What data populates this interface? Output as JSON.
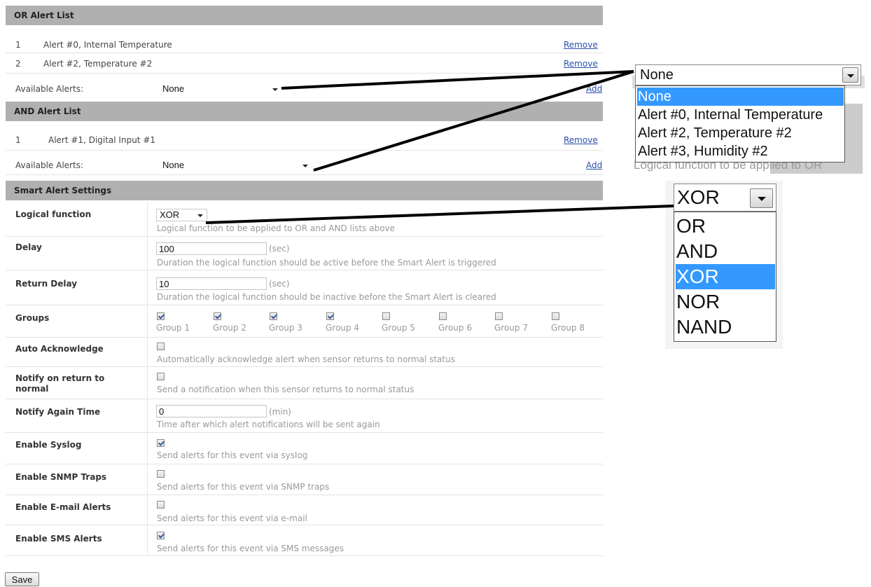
{
  "or_list": {
    "title": "OR Alert List",
    "items": [
      {
        "index": "1",
        "name": "Alert #0, Internal Temperature",
        "action": "Remove"
      },
      {
        "index": "2",
        "name": "Alert #2, Temperature #2",
        "action": "Remove"
      }
    ],
    "available_label": "Available Alerts:",
    "select_value": "None",
    "add_label": "Add"
  },
  "and_list": {
    "title": "AND Alert List",
    "items": [
      {
        "index": "1",
        "name": "Alert #1, Digital Input #1",
        "action": "Remove"
      }
    ],
    "available_label": "Available Alerts:",
    "select_value": "None",
    "add_label": "Add"
  },
  "settings": {
    "title": "Smart Alert Settings",
    "logical_function": {
      "label": "Logical function",
      "value": "XOR",
      "desc": "Logical function to be applied to OR and AND lists above"
    },
    "delay": {
      "label": "Delay",
      "value": "100",
      "unit": "(sec)",
      "desc": "Duration the logical function should be active before the Smart Alert is triggered"
    },
    "return_delay": {
      "label": "Return Delay",
      "value": "10",
      "unit": "(sec)",
      "desc": "Duration the logical function should be inactive before the Smart Alert is cleared"
    },
    "groups": {
      "label": "Groups",
      "items": [
        {
          "label": "Group 1",
          "checked": true
        },
        {
          "label": "Group 2",
          "checked": true
        },
        {
          "label": "Group 3",
          "checked": true
        },
        {
          "label": "Group 4",
          "checked": true
        },
        {
          "label": "Group 5",
          "checked": false
        },
        {
          "label": "Group 6",
          "checked": false
        },
        {
          "label": "Group 7",
          "checked": false
        },
        {
          "label": "Group 8",
          "checked": false
        }
      ]
    },
    "auto_ack": {
      "label": "Auto Acknowledge",
      "checked": false,
      "desc": "Automatically acknowledge alert when sensor returns to normal status"
    },
    "notify_return": {
      "label_line1": "Notify on return to",
      "label_line2": "normal",
      "checked": false,
      "desc": "Send a notification when this sensor returns to normal status"
    },
    "notify_again": {
      "label": "Notify Again Time",
      "value": "0",
      "unit": "(min)",
      "desc": "Time after which alert notifications will be sent again"
    },
    "syslog": {
      "label": "Enable Syslog",
      "checked": true,
      "desc": "Send alerts for this event via syslog"
    },
    "snmp": {
      "label": "Enable SNMP Traps",
      "checked": false,
      "desc": "Send alerts for this event via SNMP traps"
    },
    "email": {
      "label": "Enable E-mail Alerts",
      "checked": false,
      "desc": "Send alerts for this event via e-mail"
    },
    "sms": {
      "label": "Enable SMS Alerts",
      "checked": true,
      "desc": "Send alerts for this event via SMS messages"
    }
  },
  "save_label": "Save",
  "callout_alerts": {
    "select_value": "None",
    "options": [
      "None",
      "Alert #0, Internal Temperature",
      "Alert #2, Temperature #2",
      "Alert #3, Humidity #2"
    ],
    "selected": "None",
    "background_text": "Logical function to be applied to OR"
  },
  "callout_logic": {
    "select_value": "XOR",
    "options": [
      "OR",
      "AND",
      "XOR",
      "NOR",
      "NAND"
    ],
    "selected": "XOR"
  }
}
